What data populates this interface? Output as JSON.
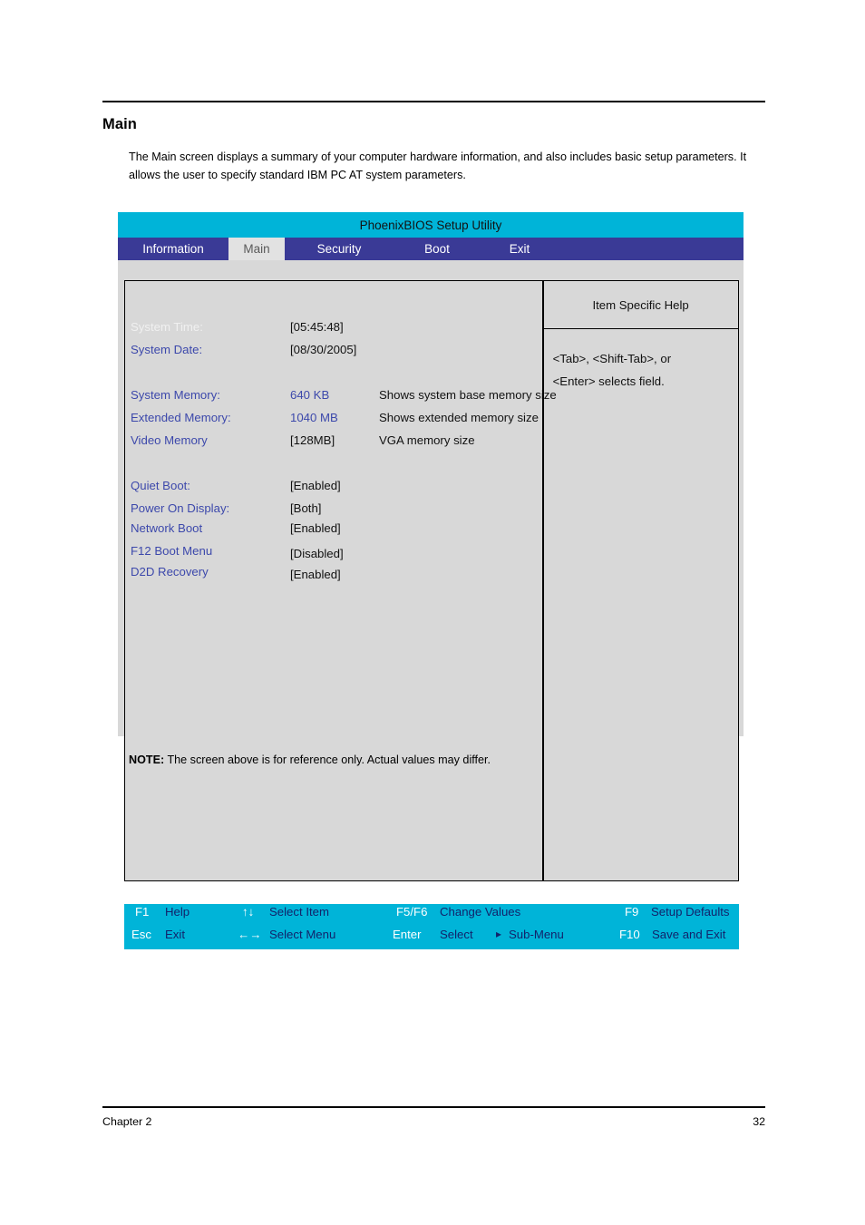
{
  "document": {
    "heading": "Main",
    "intro": "The Main screen displays a summary of your computer hardware information, and also includes basic setup parameters. It allows the user to specify standard IBM PC AT system parameters.",
    "note_label": "NOTE:",
    "note_text": "The screen above is for reference only. Actual values may differ.",
    "footer_left": "Chapter 2",
    "footer_right": "32"
  },
  "bios": {
    "title": "PhoenixBIOS Setup Utility",
    "tabs": [
      {
        "label": "Information",
        "active": false
      },
      {
        "label": "Main",
        "active": true
      },
      {
        "label": "Security",
        "active": false
      },
      {
        "label": "Boot",
        "active": false
      },
      {
        "label": "Exit",
        "active": false
      }
    ],
    "settings": [
      {
        "label": "System Time:",
        "value": "[05:45:48]",
        "desc": ""
      },
      {
        "label": "System Date:",
        "value": "[08/30/2005]",
        "desc": ""
      },
      {
        "label": "System Memory:",
        "value": "640 KB",
        "desc": "Shows system base memory size"
      },
      {
        "label": "Extended Memory:",
        "value": "1040 MB",
        "desc": "Shows extended memory size"
      },
      {
        "label": "Video Memory",
        "value": "[128MB]",
        "desc": "VGA memory size"
      },
      {
        "label": "Quiet Boot:",
        "value": "[Enabled]",
        "desc": ""
      },
      {
        "label": "Power On Display:",
        "value": "[Both]",
        "desc": ""
      },
      {
        "label": "Network Boot",
        "value": "[Enabled]",
        "desc": ""
      },
      {
        "label": "F12 Boot Menu",
        "value": "[Disabled]",
        "desc": ""
      },
      {
        "label": "D2D Recovery",
        "value": "[Enabled]",
        "desc": ""
      }
    ],
    "help": {
      "header": "Item Specific Help",
      "lines": [
        "<Tab>, <Shift-Tab>, or",
        "<Enter> selects field."
      ]
    },
    "keys": [
      {
        "key": "F1",
        "desc": "Help"
      },
      {
        "key": "↑↓",
        "desc": "Select Item"
      },
      {
        "key": "F5/F6",
        "desc": "Change Values"
      },
      {
        "key": "F9",
        "desc": "Setup Defaults"
      },
      {
        "key": "Esc",
        "desc": "Exit"
      },
      {
        "key": "←→",
        "desc": "Select Menu"
      },
      {
        "key": "Enter",
        "desc": "Select"
      },
      {
        "key": "",
        "desc": "Sub-Menu"
      },
      {
        "key": "F10",
        "desc": "Save and Exit"
      }
    ],
    "colors": {
      "title_bar": "#00b4d8",
      "tab_bar": "#3a3a96",
      "active_tab": "#e2e2e2",
      "panel": "#d8d8d8",
      "label_blue": "#3c48ab",
      "key_desc": "#12236b"
    }
  }
}
